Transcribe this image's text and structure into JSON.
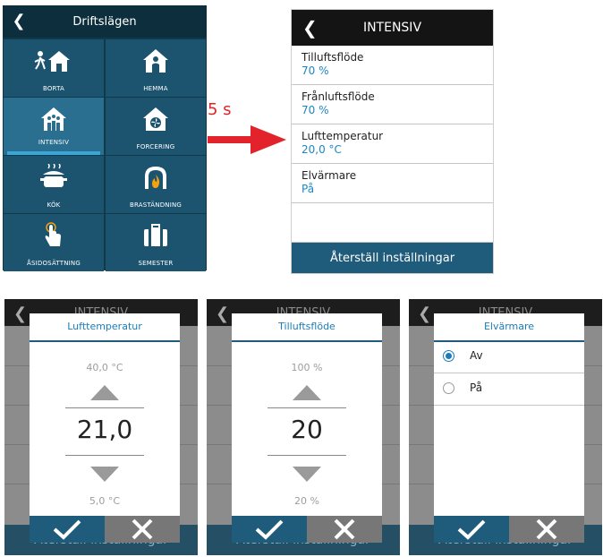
{
  "modes_panel": {
    "title": "Driftslägen",
    "tiles": [
      {
        "label": "BORTA",
        "icon": "away-house-icon"
      },
      {
        "label": "HEMMA",
        "icon": "home-house-icon"
      },
      {
        "label": "INTENSIV",
        "icon": "intensive-house-icon",
        "selected": true
      },
      {
        "label": "FORCERING",
        "icon": "fan-house-icon"
      },
      {
        "label": "KÖK",
        "icon": "cooking-pot-icon"
      },
      {
        "label": "BRASTÄNDNING",
        "icon": "fireplace-icon"
      },
      {
        "label": "ÅSIDOSÄTTNING",
        "icon": "touch-hand-icon"
      },
      {
        "label": "SEMESTER",
        "icon": "suitcase-icon"
      }
    ]
  },
  "annotation": {
    "delay": "5 s",
    "color": "#e3232b"
  },
  "intensiv_panel": {
    "title": "INTENSIV",
    "rows": [
      {
        "name": "Tilluftsflöde",
        "value": "70 %"
      },
      {
        "name": "Frånluftsflöde",
        "value": "70 %"
      },
      {
        "name": "Lufttemperatur",
        "value": "20,0 °C"
      },
      {
        "name": "Elvärmare",
        "value": "På"
      }
    ],
    "reset_label": "Återställ inställningar"
  },
  "background": {
    "title": "INTENSIV",
    "reset_label": "Återställ inställningar"
  },
  "dialogs": {
    "temp": {
      "title": "Lufttemperatur",
      "max": "40,0 °C",
      "value": "21,0",
      "min": "5,0 °C"
    },
    "flow": {
      "title": "Tilluftsflöde",
      "max": "100 %",
      "value": "20",
      "min": "20 %"
    },
    "heater": {
      "title": "Elvärmare",
      "options": [
        "Av",
        "På"
      ],
      "selected": "Av"
    }
  },
  "colors": {
    "accent": "#1d7cb8",
    "dark_blue": "#1f5b7a",
    "tile": "#1c5470"
  }
}
